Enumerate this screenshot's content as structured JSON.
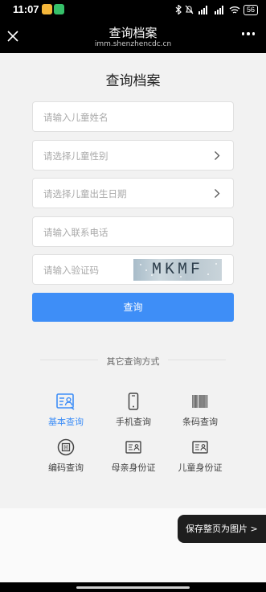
{
  "status_bar": {
    "time": "11:07",
    "battery": "56"
  },
  "nav": {
    "title": "查询档案",
    "url": "imm.shenzhencdc.cn"
  },
  "page": {
    "title": "查询档案"
  },
  "form": {
    "name_placeholder": "请输入儿童姓名",
    "gender_placeholder": "请选择儿童性别",
    "birthdate_placeholder": "请选择儿童出生日期",
    "phone_placeholder": "请输入联系电话",
    "captcha_placeholder": "请输入验证码",
    "captcha_text": "MKMF",
    "submit_label": "查询"
  },
  "other_methods": {
    "label": "其它查询方式",
    "options": [
      {
        "label": "基本查询",
        "icon": "user-card-icon",
        "active": true
      },
      {
        "label": "手机查询",
        "icon": "phone-icon"
      },
      {
        "label": "条码查询",
        "icon": "barcode-icon"
      },
      {
        "label": "编码查询",
        "icon": "code-icon"
      },
      {
        "label": "母亲身份证",
        "icon": "id-card-icon"
      },
      {
        "label": "儿童身份证",
        "icon": "id-card-icon"
      }
    ]
  },
  "save_page_label": "保存整页为图片 >",
  "colors": {
    "accent": "#3e8ef7",
    "background": "#f2f2f2",
    "navbar": "#000000"
  }
}
